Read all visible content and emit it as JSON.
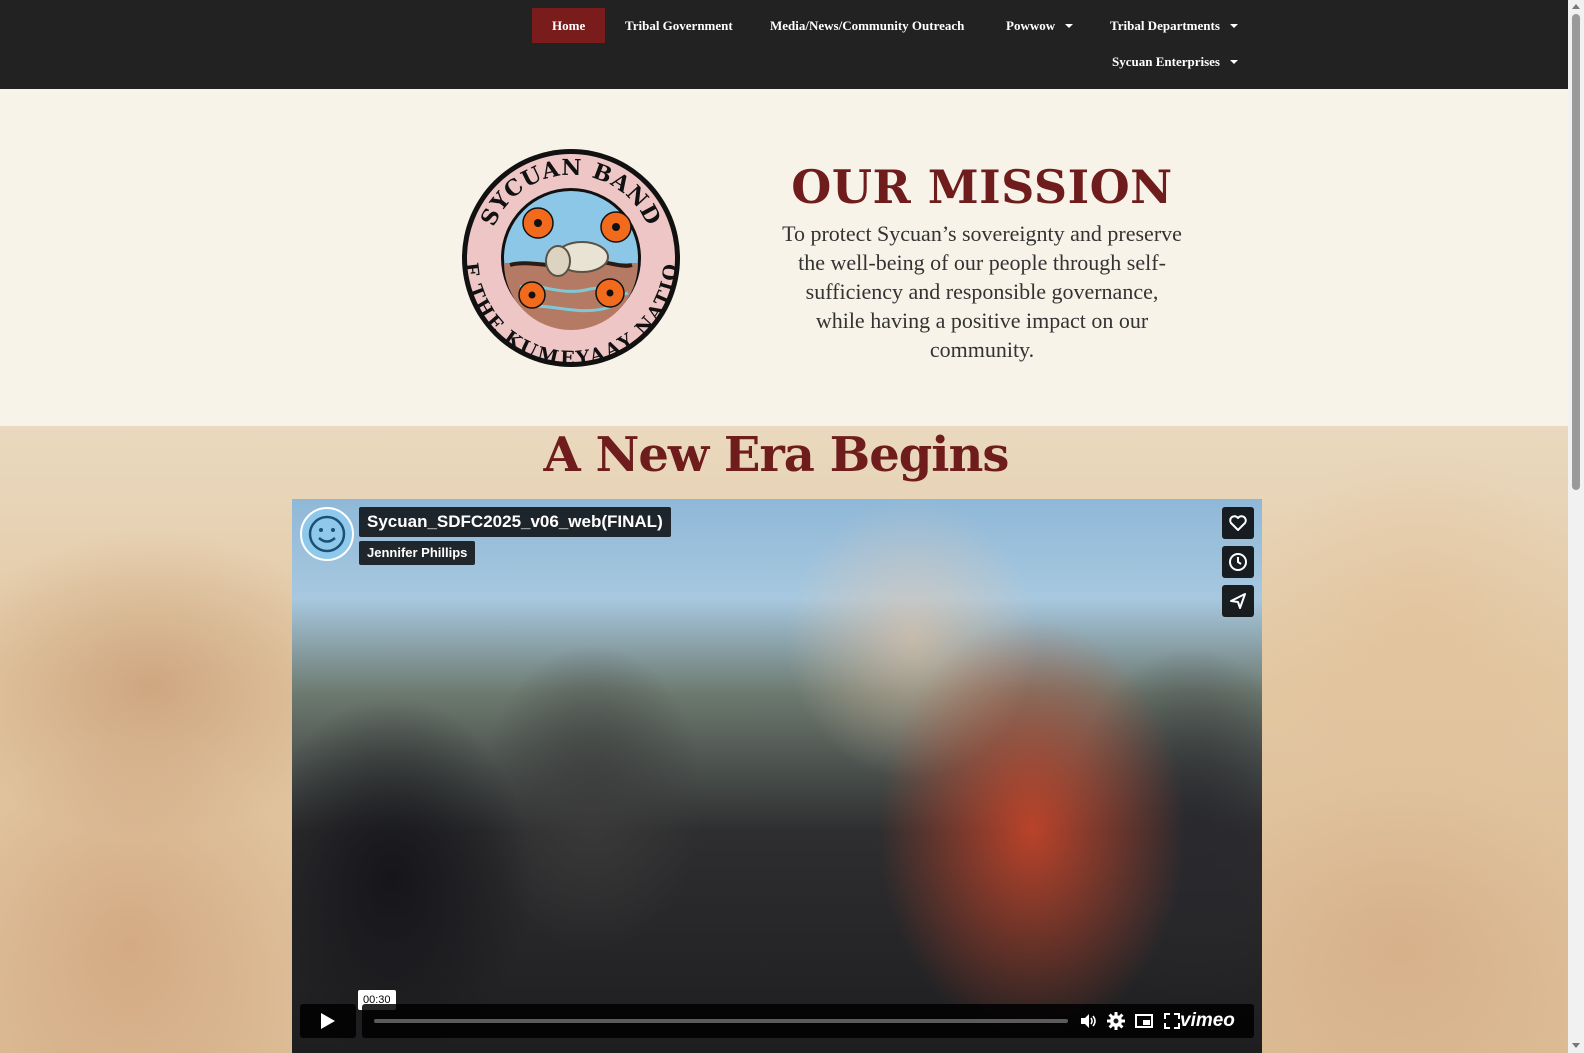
{
  "nav": {
    "items": [
      {
        "label": "Home"
      },
      {
        "label": "Tribal Government"
      },
      {
        "label": "Media/News/Community Outreach"
      },
      {
        "label": "Powwow"
      },
      {
        "label": "Tribal Departments"
      },
      {
        "label": "Sycuan Enterprises"
      }
    ],
    "active_color": "#7a1c1c",
    "background": "#222222"
  },
  "mission": {
    "seal_text_top": "SYCUAN BAND",
    "seal_text_bottom": "OF THE KUMEYAAY NATION",
    "title": "OUR MISSION",
    "body": "To protect Sycuan’s sovereignty and preserve the well-being of our people through self-sufficiency and responsible governance, while having a positive impact on our community.",
    "title_color": "#6e1c1c"
  },
  "era": {
    "title": "A New Era Begins"
  },
  "video": {
    "title": "Sycuan_SDFC2025_v06_web(FINAL)",
    "author": "Jennifer Phillips",
    "time": "00:30",
    "brand": "vimeo",
    "progress": 0.0,
    "side_icons": [
      "heart-icon",
      "clock-icon",
      "share-icon"
    ],
    "control_icons": [
      "play-icon",
      "volume-icon",
      "settings-icon",
      "picture-in-picture-icon",
      "fullscreen-icon"
    ]
  }
}
